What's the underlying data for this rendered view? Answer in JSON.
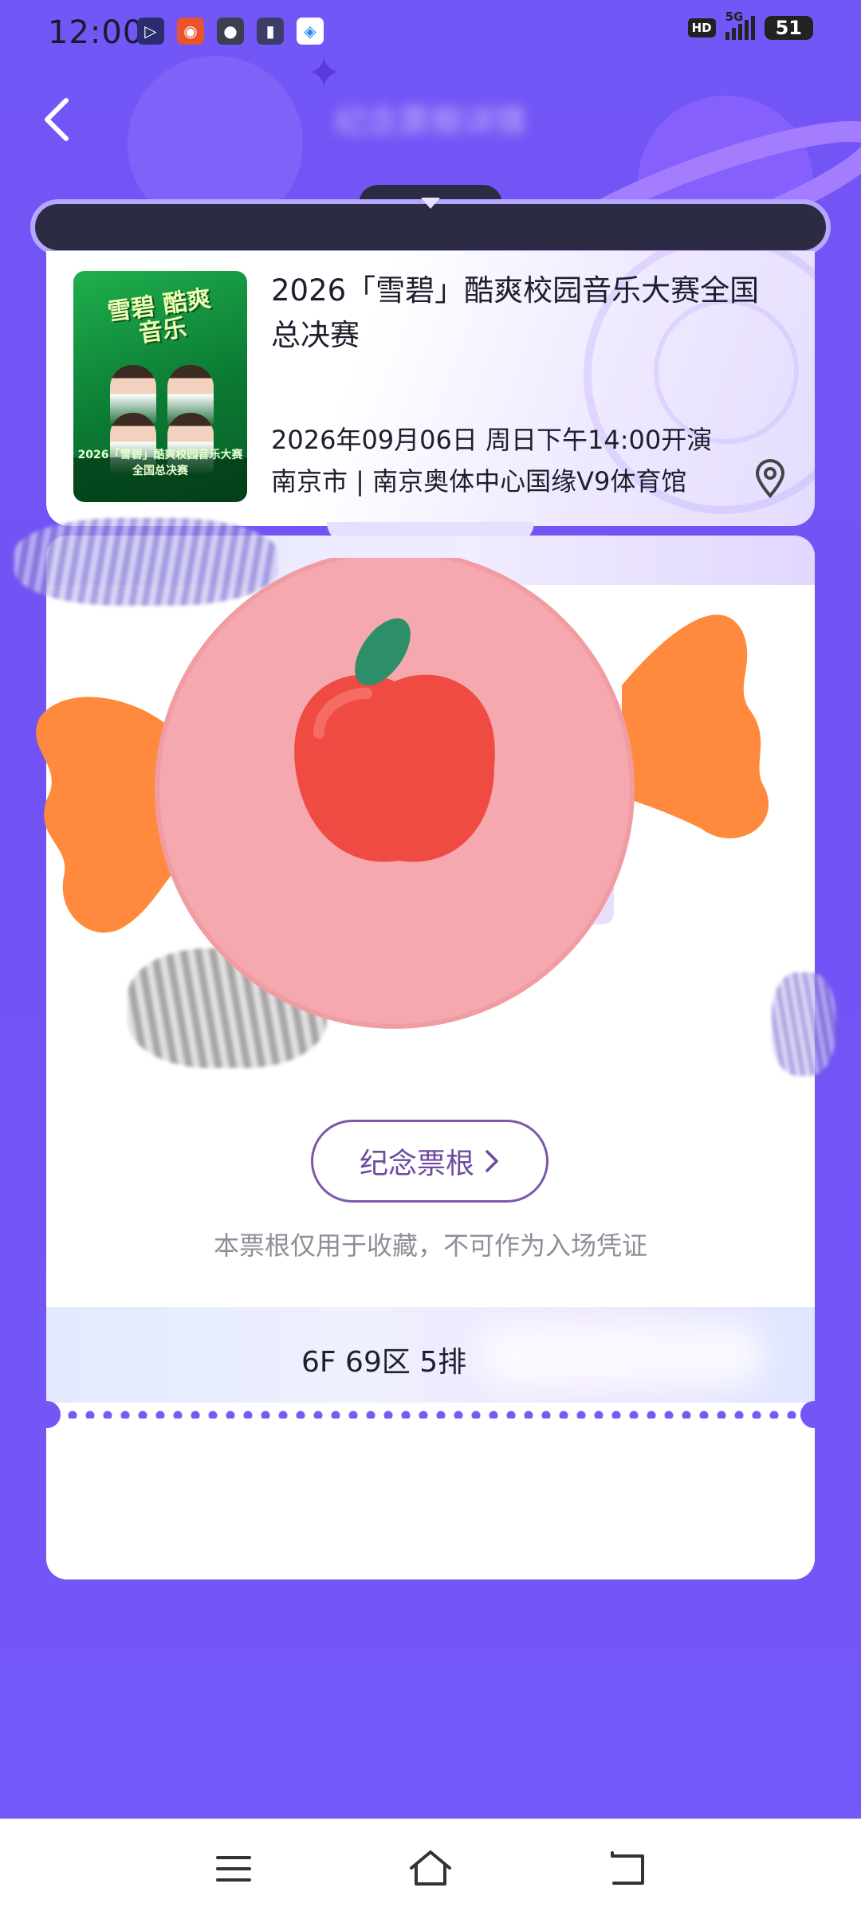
{
  "status_bar": {
    "time": "12:00",
    "apps": [
      {
        "name": "video-app-icon",
        "glyph": "▷",
        "color": "#2b2d6e"
      },
      {
        "name": "weibo-icon",
        "glyph": "◉",
        "color": "#e8542e"
      },
      {
        "name": "wechat-icon",
        "glyph": "●",
        "color": "#3a3f52"
      },
      {
        "name": "reader-app-icon",
        "glyph": "▮",
        "color": "#3b3f67"
      },
      {
        "name": "droplet-app-icon",
        "glyph": "◈",
        "color": "#ffffff"
      }
    ],
    "hd": "HD",
    "network": "5G",
    "battery": "51"
  },
  "header": {
    "title": "纪念票根详情"
  },
  "event": {
    "title": "2026「雪碧」酷爽校园音乐大赛全国总决赛",
    "datetime": "2026年09月06日 周日下午14:00开演",
    "venue": "南京市 | 南京奥体中心国缘V9体育馆",
    "poster": {
      "headline": "雪碧 酷爽音乐",
      "caption": "2026「雪碧」酷爽校园音乐大赛 全国总决赛"
    }
  },
  "stub": {
    "button_label": "纪念票根",
    "note": "本票根仅用于收藏，不可作为入场凭证",
    "seat": "6F 69区  5排"
  },
  "colors": {
    "background": "#7356f6",
    "ticket_dark": "#2c2b44",
    "accent_purple": "#6e4aa0",
    "candy_pink": "#f7a7aa",
    "candy_orange": "#ff8a3d",
    "apple_red": "#ef4b43",
    "leaf_green": "#2d8f6a"
  }
}
